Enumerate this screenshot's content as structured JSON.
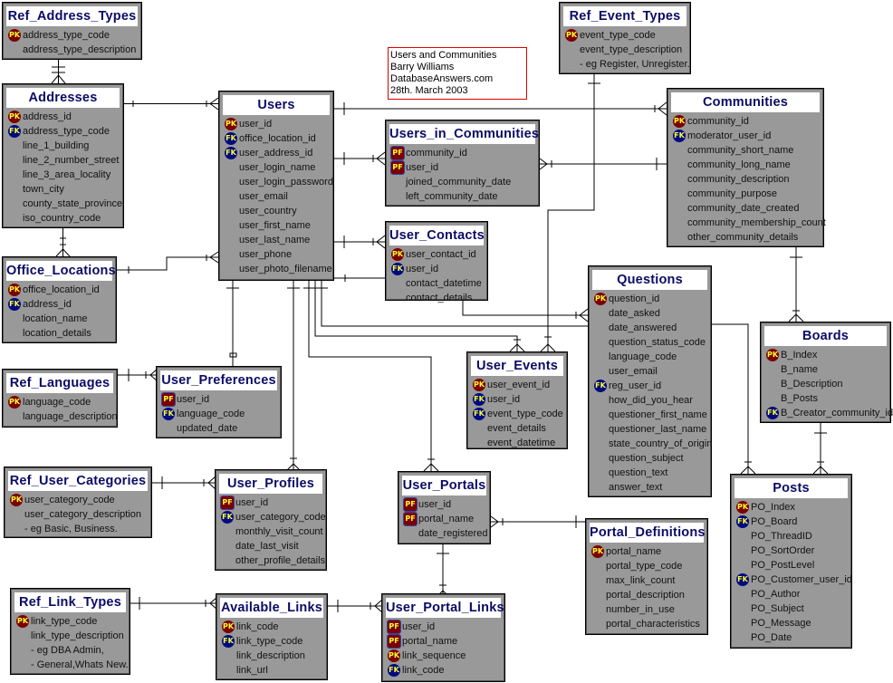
{
  "note": {
    "lines": [
      "Users and Communities",
      "Barry Williams",
      "DatabaseAnswers.com",
      "28th. March 2003"
    ]
  },
  "entities": {
    "ref_address_types": {
      "title": "Ref_Address_Types",
      "rows": [
        {
          "key": "PK",
          "text": "address_type_code"
        },
        {
          "key": "",
          "text": "address_type_description"
        }
      ]
    },
    "addresses": {
      "title": "Addresses",
      "rows": [
        {
          "key": "PK",
          "text": "address_id"
        },
        {
          "key": "FK",
          "text": "address_type_code"
        },
        {
          "key": "",
          "text": "line_1_building"
        },
        {
          "key": "",
          "text": "line_2_number_street"
        },
        {
          "key": "",
          "text": "line_3_area_locality"
        },
        {
          "key": "",
          "text": "town_city"
        },
        {
          "key": "",
          "text": "county_state_province"
        },
        {
          "key": "",
          "text": "iso_country_code"
        }
      ]
    },
    "office_locations": {
      "title": "Office_Locations",
      "rows": [
        {
          "key": "PK",
          "text": "office_location_id"
        },
        {
          "key": "FK",
          "text": "address_id"
        },
        {
          "key": "",
          "text": "location_name"
        },
        {
          "key": "",
          "text": "location_details"
        }
      ]
    },
    "users": {
      "title": "Users",
      "rows": [
        {
          "key": "PK",
          "text": "user_id"
        },
        {
          "key": "FK",
          "text": "office_location_id"
        },
        {
          "key": "FK",
          "text": "user_address_id"
        },
        {
          "key": "",
          "text": "user_login_name"
        },
        {
          "key": "",
          "text": "user_login_password"
        },
        {
          "key": "",
          "text": "user_email"
        },
        {
          "key": "",
          "text": "user_country"
        },
        {
          "key": "",
          "text": "user_first_name"
        },
        {
          "key": "",
          "text": "user_last_name"
        },
        {
          "key": "",
          "text": "user_phone"
        },
        {
          "key": "",
          "text": "user_photo_filename"
        }
      ]
    },
    "users_in_communities": {
      "title": "Users_in_Communities",
      "rows": [
        {
          "key": "PF",
          "text": "community_id"
        },
        {
          "key": "PF",
          "text": "user_id"
        },
        {
          "key": "",
          "text": "joined_community_date"
        },
        {
          "key": "",
          "text": "left_community_date"
        }
      ]
    },
    "user_contacts": {
      "title": "User_Contacts",
      "rows": [
        {
          "key": "PK",
          "text": "user_contact_id"
        },
        {
          "key": "FK",
          "text": "user_id"
        },
        {
          "key": "",
          "text": "contact_datetime"
        },
        {
          "key": "",
          "text": "contact_details"
        }
      ]
    },
    "ref_event_types": {
      "title": "Ref_Event_Types",
      "rows": [
        {
          "key": "PK",
          "text": "event_type_code"
        },
        {
          "key": "",
          "text": "event_type_description"
        },
        {
          "key": "",
          "text": "- eg Register, Unregister."
        }
      ]
    },
    "communities": {
      "title": "Communities",
      "rows": [
        {
          "key": "PK",
          "text": "community_id"
        },
        {
          "key": "FK",
          "text": "moderator_user_id"
        },
        {
          "key": "",
          "text": "community_short_name"
        },
        {
          "key": "",
          "text": "community_long_name"
        },
        {
          "key": "",
          "text": "community_description"
        },
        {
          "key": "",
          "text": "community_purpose"
        },
        {
          "key": "",
          "text": "community_date_created"
        },
        {
          "key": "",
          "text": "community_membership_count"
        },
        {
          "key": "",
          "text": "other_community_details"
        }
      ]
    },
    "questions": {
      "title": "Questions",
      "rows": [
        {
          "key": "PK",
          "text": "question_id"
        },
        {
          "key": "",
          "text": "date_asked"
        },
        {
          "key": "",
          "text": "date_answered"
        },
        {
          "key": "",
          "text": "question_status_code"
        },
        {
          "key": "",
          "text": "language_code"
        },
        {
          "key": "",
          "text": "user_email"
        },
        {
          "key": "FK",
          "text": "reg_user_id"
        },
        {
          "key": "",
          "text": "how_did_you_hear"
        },
        {
          "key": "",
          "text": "questioner_first_name"
        },
        {
          "key": "",
          "text": "questioner_last_name"
        },
        {
          "key": "",
          "text": "state_country_of_origin"
        },
        {
          "key": "",
          "text": "question_subject"
        },
        {
          "key": "",
          "text": "question_text"
        },
        {
          "key": "",
          "text": "answer_text"
        }
      ]
    },
    "boards": {
      "title": "Boards",
      "rows": [
        {
          "key": "PK",
          "text": "B_Index"
        },
        {
          "key": "",
          "text": "B_name"
        },
        {
          "key": "",
          "text": "B_Description"
        },
        {
          "key": "",
          "text": "B_Posts"
        },
        {
          "key": "FK",
          "text": "B_Creator_community_id"
        }
      ]
    },
    "user_events": {
      "title": "User_Events",
      "rows": [
        {
          "key": "PK",
          "text": "user_event_id"
        },
        {
          "key": "FK",
          "text": "user_id"
        },
        {
          "key": "FK",
          "text": "event_type_code"
        },
        {
          "key": "",
          "text": "event_details"
        },
        {
          "key": "",
          "text": "event_datetime"
        }
      ]
    },
    "ref_languages": {
      "title": "Ref_Languages",
      "rows": [
        {
          "key": "PK",
          "text": "language_code"
        },
        {
          "key": "",
          "text": "language_description"
        }
      ]
    },
    "user_preferences": {
      "title": "User_Preferences",
      "rows": [
        {
          "key": "PF",
          "text": "user_id"
        },
        {
          "key": "FK",
          "text": "language_code"
        },
        {
          "key": "",
          "text": "updated_date"
        }
      ]
    },
    "ref_user_categories": {
      "title": "Ref_User_Categories",
      "rows": [
        {
          "key": "PK",
          "text": "user_category_code"
        },
        {
          "key": "",
          "text": "user_category_description"
        },
        {
          "key": "",
          "text": "- eg Basic, Business."
        }
      ]
    },
    "user_profiles": {
      "title": "User_Profiles",
      "rows": [
        {
          "key": "PF",
          "text": "user_id"
        },
        {
          "key": "FK",
          "text": "user_category_code"
        },
        {
          "key": "",
          "text": "monthly_visit_count"
        },
        {
          "key": "",
          "text": "date_last_visit"
        },
        {
          "key": "",
          "text": "other_profile_details"
        }
      ]
    },
    "user_portals": {
      "title": "User_Portals",
      "rows": [
        {
          "key": "PF",
          "text": "user_id"
        },
        {
          "key": "PF",
          "text": "portal_name"
        },
        {
          "key": "",
          "text": "date_registered"
        }
      ]
    },
    "portal_definitions": {
      "title": "Portal_Definitions",
      "rows": [
        {
          "key": "PK",
          "text": "portal_name"
        },
        {
          "key": "",
          "text": "portal_type_code"
        },
        {
          "key": "",
          "text": "max_link_count"
        },
        {
          "key": "",
          "text": "portal_description"
        },
        {
          "key": "",
          "text": "number_in_use"
        },
        {
          "key": "",
          "text": "portal_characteristics"
        }
      ]
    },
    "posts": {
      "title": "Posts",
      "rows": [
        {
          "key": "PK",
          "text": "PO_Index"
        },
        {
          "key": "FK",
          "text": "PO_Board"
        },
        {
          "key": "",
          "text": "PO_ThreadID"
        },
        {
          "key": "",
          "text": "PO_SortOrder"
        },
        {
          "key": "",
          "text": "PO_PostLevel"
        },
        {
          "key": "FK",
          "text": "PO_Customer_user_id"
        },
        {
          "key": "",
          "text": "PO_Author"
        },
        {
          "key": "",
          "text": "PO_Subject"
        },
        {
          "key": "",
          "text": "PO_Message"
        },
        {
          "key": "",
          "text": "PO_Date"
        }
      ]
    },
    "ref_link_types": {
      "title": "Ref_Link_Types",
      "rows": [
        {
          "key": "PK",
          "text": "link_type_code"
        },
        {
          "key": "",
          "text": "link_type_description"
        },
        {
          "key": "",
          "text": "- eg DBA Admin,"
        },
        {
          "key": "",
          "text": "- General,Whats New."
        }
      ]
    },
    "available_links": {
      "title": "Available_Links",
      "rows": [
        {
          "key": "PK",
          "text": "link_code"
        },
        {
          "key": "FK",
          "text": "link_type_code"
        },
        {
          "key": "",
          "text": "link_description"
        },
        {
          "key": "",
          "text": "link_url"
        }
      ]
    },
    "user_portal_links": {
      "title": "User_Portal_Links",
      "rows": [
        {
          "key": "PF",
          "text": "user_id"
        },
        {
          "key": "PF",
          "text": "portal_name"
        },
        {
          "key": "PK",
          "text": "link_sequence"
        },
        {
          "key": "FK",
          "text": "link_code"
        }
      ]
    }
  }
}
